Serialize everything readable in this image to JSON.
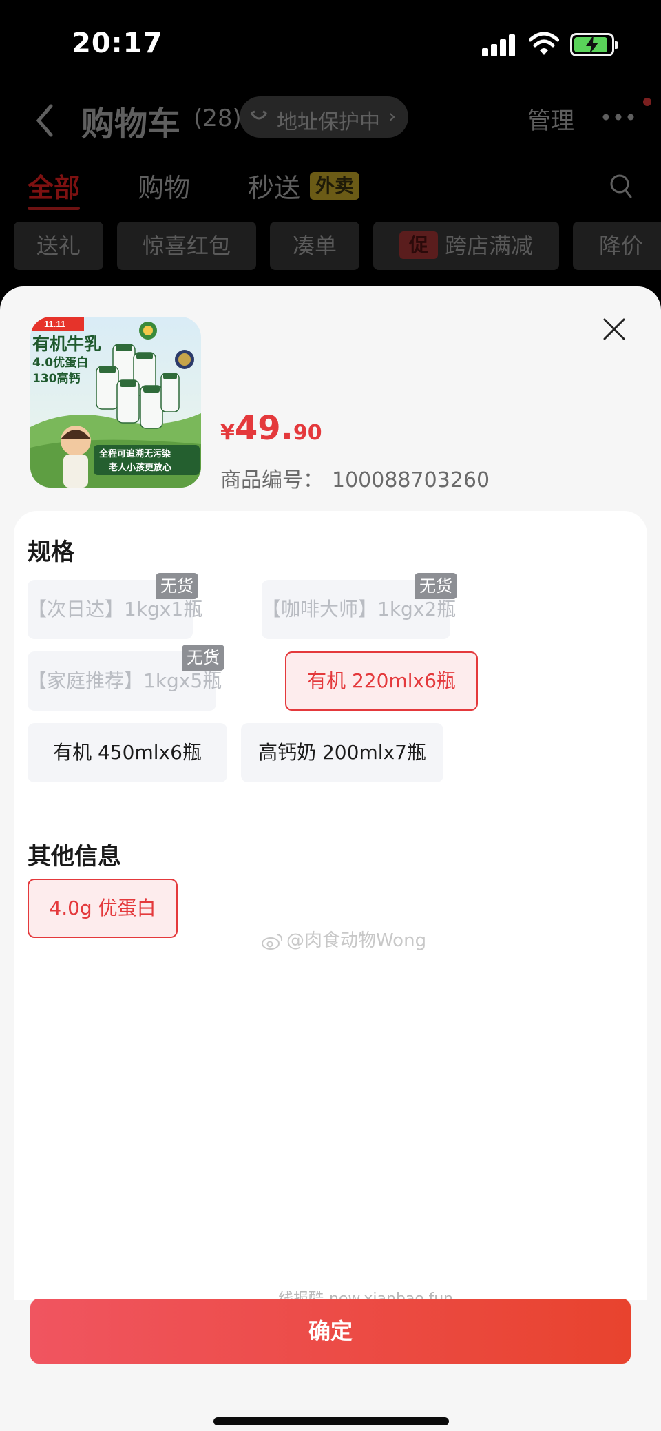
{
  "status_bar": {
    "time": "20:17"
  },
  "cart": {
    "title": "购物车",
    "count": "(28)",
    "address_pill": "地址保护中",
    "manage": "管理",
    "tabs": [
      {
        "label": "全部",
        "active": true
      },
      {
        "label": "购物",
        "active": false
      },
      {
        "label": "秒送",
        "active": false
      }
    ],
    "takeout_badge": "外卖",
    "chips": [
      "送礼",
      "惊喜红包",
      "凑单",
      "跨店满减",
      "降价"
    ],
    "promo_badge": "促"
  },
  "product": {
    "image_text": {
      "corner_tag": "11.11",
      "headline": "有机牛乳",
      "line2": "4.0优蛋白",
      "line3": "130高钙",
      "slogan1": "全程可追溯无污染",
      "slogan2": "老人小孩更放心"
    },
    "price": {
      "currency": "¥",
      "integer": "49.",
      "decimal": "90"
    },
    "sku_label": "商品编号：",
    "sku_number": "100088703260"
  },
  "spec": {
    "title": "规格",
    "options": [
      {
        "label": "【次日达】1kgx1瓶",
        "state": "disabled",
        "badge": "无货"
      },
      {
        "label": "【咖啡大师】1kgx2瓶",
        "state": "disabled",
        "badge": "无货"
      },
      {
        "label": "【家庭推荐】1kgx5瓶",
        "state": "disabled",
        "badge": "无货"
      },
      {
        "label": "有机 220mlx6瓶",
        "state": "selected",
        "badge": ""
      },
      {
        "label": "有机 450mlx6瓶",
        "state": "normal",
        "badge": ""
      },
      {
        "label": "高钙奶 200mlx7瓶",
        "state": "normal",
        "badge": ""
      }
    ]
  },
  "other_info": {
    "title": "其他信息",
    "options": [
      {
        "label": "4.0g 优蛋白",
        "state": "selected"
      }
    ]
  },
  "overlay_watermark": "@肉食动物Wong",
  "watermark": "线报酷-new.xianbao.fun",
  "confirm_label": "确定",
  "colors": {
    "accent": "#e4393c",
    "button_gradient_start": "#f05560",
    "button_gradient_end": "#e8432e",
    "sheet_bg": "#f6f6f6"
  }
}
